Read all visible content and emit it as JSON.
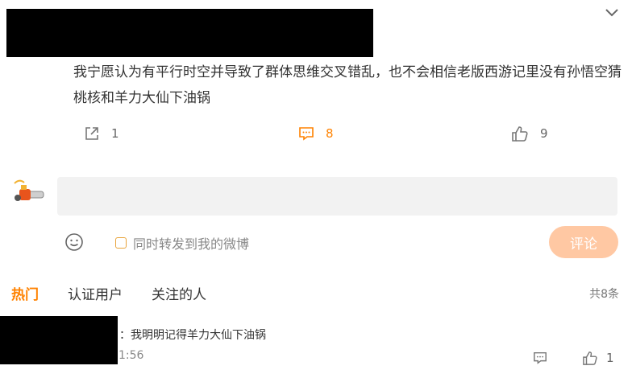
{
  "post": {
    "text": "我宁愿认为有平行时空并导致了群体思维交叉错乱，也不会相信老版西游记里没有孙悟空猜桃核和羊力大仙下油锅",
    "share_count": "1",
    "comment_count": "8",
    "like_count": "9"
  },
  "composer": {
    "forward_label": "同时转发到我的微博",
    "submit_label": "评论"
  },
  "tabs": [
    "热门",
    "认证用户",
    "关注的人"
  ],
  "total_label": "共8条",
  "reply": {
    "text": "：我明明记得羊力大仙下油锅",
    "time": "1:56",
    "like_count": "1"
  },
  "icons": {
    "share": "share-icon",
    "comment": "comment-icon",
    "like": "like-icon",
    "emoji": "emoji-icon",
    "collapse": "chevron-down-icon"
  },
  "colors": {
    "accent": "#ff8200",
    "submit_bg": "#ffc8a3",
    "input_bg": "#f2f2f2"
  }
}
